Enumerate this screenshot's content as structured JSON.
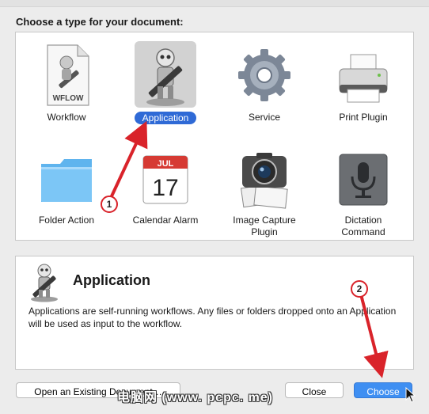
{
  "dialog": {
    "heading": "Choose a type for your document:",
    "types": [
      {
        "label": "Workflow",
        "badge": "WFLOW",
        "icon": "workflow-document-icon",
        "selected": false
      },
      {
        "label": "Application",
        "icon": "automator-robot-icon",
        "selected": true
      },
      {
        "label": "Service",
        "icon": "gear-icon",
        "selected": false
      },
      {
        "label": "Print Plugin",
        "icon": "printer-icon",
        "selected": false
      },
      {
        "label": "Folder Action",
        "icon": "folder-icon",
        "selected": false
      },
      {
        "label": "Calendar Alarm",
        "month": "JUL",
        "day": "17",
        "icon": "calendar-icon",
        "selected": false
      },
      {
        "label_line1": "Image Capture",
        "label_line2": "Plugin",
        "icon": "camera-icon",
        "selected": false
      },
      {
        "label_line1": "Dictation",
        "label_line2": "Command",
        "icon": "microphone-icon",
        "selected": false
      }
    ],
    "description": {
      "title": "Application",
      "text": "Applications are self-running workflows. Any files or folders dropped onto an Application will be used as input to the workflow.",
      "icon": "automator-robot-icon"
    },
    "buttons": {
      "open_existing": "Open an Existing Document…",
      "close": "Close",
      "choose": "Choose"
    }
  },
  "annotations": {
    "callout_1": "1",
    "callout_2": "2",
    "watermark": "电脑网 (www. pcpc. me)",
    "accent_color": "#d9232a"
  }
}
